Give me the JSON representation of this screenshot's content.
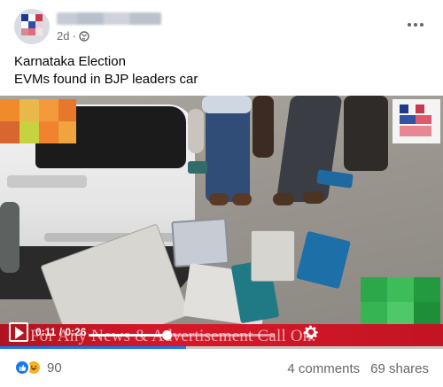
{
  "post": {
    "time": "2d",
    "separator": "·",
    "text_line1": "Karnataka Election",
    "text_line2": "EVMs found in BJP leaders car"
  },
  "video": {
    "current_time": "0:11",
    "duration": "0:26",
    "time_separator": " / ",
    "progress_fraction": 0.42,
    "ticker_text": "For Any News & Advertisement Call On:"
  },
  "footer": {
    "reaction_count": "90",
    "comments": "4 comments",
    "shares": "69 shares"
  },
  "colors": {
    "accent": "#1877f2",
    "ticker_red": "#d9182a",
    "secondary_text": "#65676b"
  },
  "icons": [
    "globe-icon",
    "more-icon",
    "play-icon",
    "settings-icon",
    "like-icon",
    "haha-icon"
  ]
}
